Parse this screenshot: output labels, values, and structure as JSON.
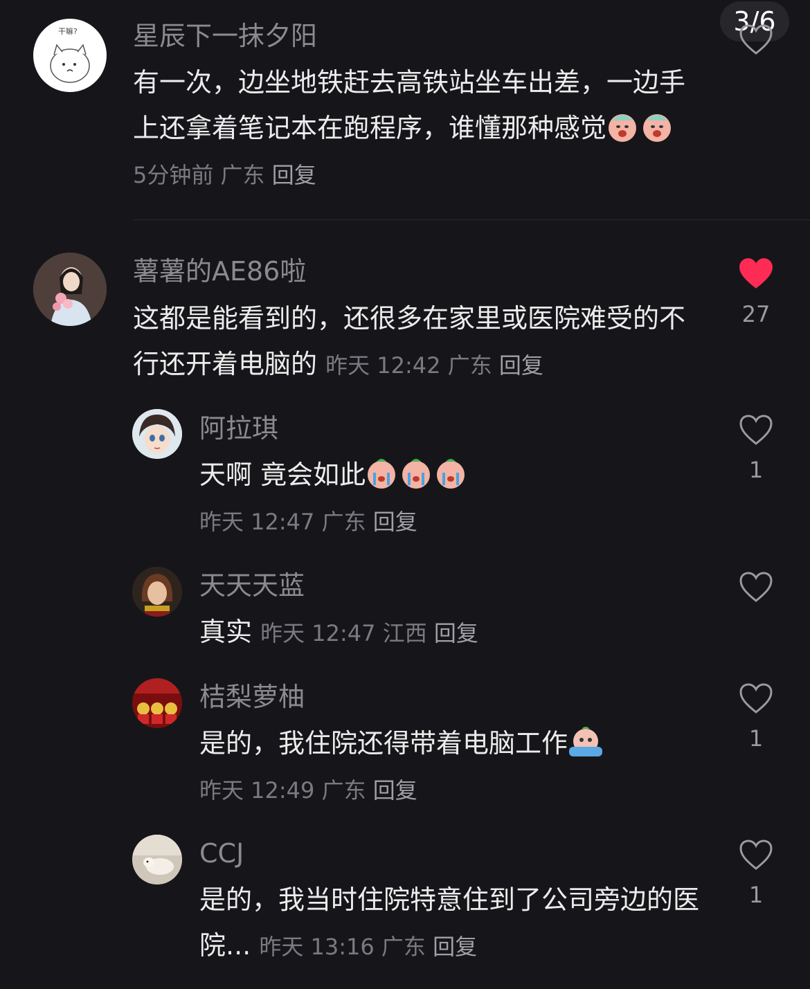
{
  "page_counter": "3/6",
  "comments": [
    {
      "username": "星辰下一抹夕阳",
      "text": "有一次，边坐地铁赶去高铁站坐车出差，一边手上还拿着笔记本在跑程序，谁懂那种感觉",
      "time": "5分钟前",
      "location": "广东",
      "reply_label": "回复",
      "avatar_text": "干嘛?"
    },
    {
      "username": "薯薯的AE86啦",
      "text": "这都是能看到的，还很多在家里或医院难受的不行还开着电脑的",
      "time": "昨天 12:42",
      "location": "广东",
      "reply_label": "回复",
      "like_count": "27"
    }
  ],
  "replies": [
    {
      "username": "阿拉琪",
      "text": "天啊 竟会如此",
      "time": "昨天 12:47",
      "location": "广东",
      "reply_label": "回复",
      "like_count": "1"
    },
    {
      "username": "天天天蓝",
      "text": "真实",
      "time": "昨天 12:47",
      "location": "江西",
      "reply_label": "回复",
      "like_count": ""
    },
    {
      "username": "桔梨萝柚",
      "text": "是的，我住院还得带着电脑工作",
      "time": "昨天 12:49",
      "location": "广东",
      "reply_label": "回复",
      "like_count": "1"
    },
    {
      "username": "CCJ",
      "text": "是的，我当时住院特意住到了公司旁边的医院...",
      "time": "昨天 13:16",
      "location": "广东",
      "reply_label": "回复",
      "like_count": "1"
    }
  ],
  "colors": {
    "background": "#16161a",
    "liked_heart": "#fe2c55",
    "meta_text": "#7a7a80"
  }
}
